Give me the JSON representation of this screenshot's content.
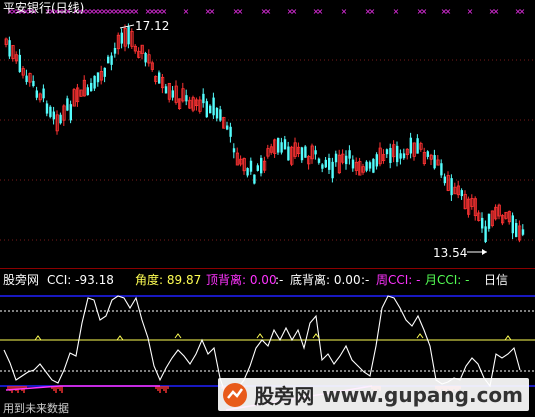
{
  "top_panel": {
    "title": "平安银行(日线)",
    "high_label": "17.12",
    "low_label": "13.54"
  },
  "bottom_panel": {
    "indicator_name": "股旁网",
    "cci_label": "CCI: -93.18",
    "angle_label": "角度: 89.87",
    "top_div_label": "顶背离: 0.00",
    "sep1": ":-",
    "bottom_div_label": "底背离: 0.00",
    "sep2": ":-",
    "week_cci_label": "周CCI: -",
    "month_cci_label": "月CCI: -",
    "day_label": "日信"
  },
  "footer_text": "用到未来数据",
  "watermark": {
    "cn": "股旁网",
    "url": "www.gupang.com"
  },
  "colors": {
    "up": "#ff3333",
    "down": "#54fcfc",
    "magenta": "#ff33ff",
    "yellow": "#ffff54",
    "blue": "#2020ff",
    "white": "#ffffff",
    "green": "#54ff54",
    "brown_sep": "#8b0000"
  },
  "chart_data": [
    {
      "type": "candlestick",
      "title": "平安银行(日线)",
      "annotations": [
        "17.12",
        "13.54"
      ],
      "y_high": 17.12,
      "y_low": 13.54
    },
    {
      "type": "line",
      "title": "CCI",
      "series": [
        {
          "name": "CCI",
          "values": [
            -93.18
          ]
        }
      ]
    }
  ]
}
